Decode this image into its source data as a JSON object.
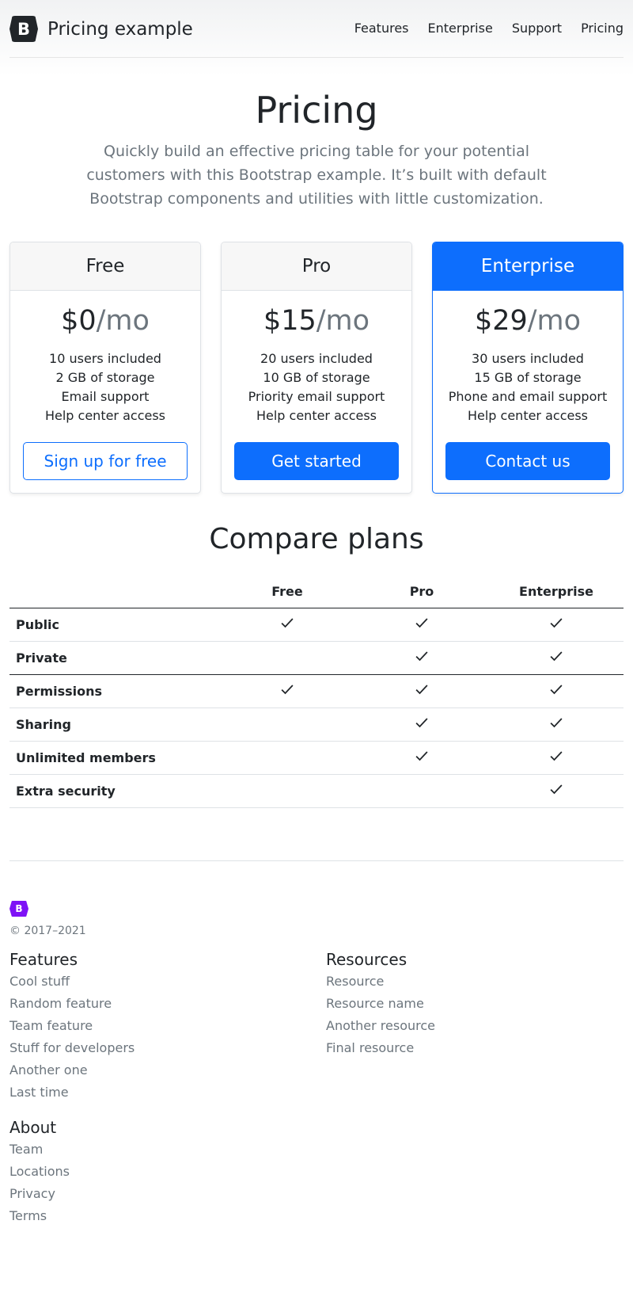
{
  "header": {
    "brand_letter": "B",
    "brand_name": "Pricing example",
    "nav": [
      "Features",
      "Enterprise",
      "Support",
      "Pricing"
    ]
  },
  "hero": {
    "title": "Pricing",
    "lead": "Quickly build an effective pricing table for your potential customers with this Bootstrap example. It’s built with default Bootstrap components and utilities with little customization."
  },
  "plans": [
    {
      "name": "Free",
      "price": "$0",
      "per": "/mo",
      "features": [
        "10 users included",
        "2 GB of storage",
        "Email support",
        "Help center access"
      ],
      "cta": "Sign up for free"
    },
    {
      "name": "Pro",
      "price": "$15",
      "per": "/mo",
      "features": [
        "20 users included",
        "10 GB of storage",
        "Priority email support",
        "Help center access"
      ],
      "cta": "Get started"
    },
    {
      "name": "Enterprise",
      "price": "$29",
      "per": "/mo",
      "features": [
        "30 users included",
        "15 GB of storage",
        "Phone and email support",
        "Help center access"
      ],
      "cta": "Contact us"
    }
  ],
  "compare": {
    "title": "Compare plans",
    "columns": [
      "Free",
      "Pro",
      "Enterprise"
    ],
    "rows": [
      {
        "label": "Public",
        "checks": [
          true,
          true,
          true
        ]
      },
      {
        "label": "Private",
        "checks": [
          false,
          true,
          true
        ]
      },
      {
        "label": "Permissions",
        "checks": [
          true,
          true,
          true
        ]
      },
      {
        "label": "Sharing",
        "checks": [
          false,
          true,
          true
        ]
      },
      {
        "label": "Unlimited members",
        "checks": [
          false,
          true,
          true
        ]
      },
      {
        "label": "Extra security",
        "checks": [
          false,
          false,
          true
        ]
      }
    ]
  },
  "footer": {
    "logo_letter": "B",
    "copyright": "© 2017–2021",
    "features": {
      "title": "Features",
      "links": [
        "Cool stuff",
        "Random feature",
        "Team feature",
        "Stuff for developers",
        "Another one",
        "Last time"
      ]
    },
    "resources": {
      "title": "Resources",
      "links": [
        "Resource",
        "Resource name",
        "Another resource",
        "Final resource"
      ]
    },
    "about": {
      "title": "About",
      "links": [
        "Team",
        "Locations",
        "Privacy",
        "Terms"
      ]
    }
  },
  "colors": {
    "primary": "#0d6efd",
    "footer_logo": "#7e12f6",
    "muted": "#6c757d"
  }
}
